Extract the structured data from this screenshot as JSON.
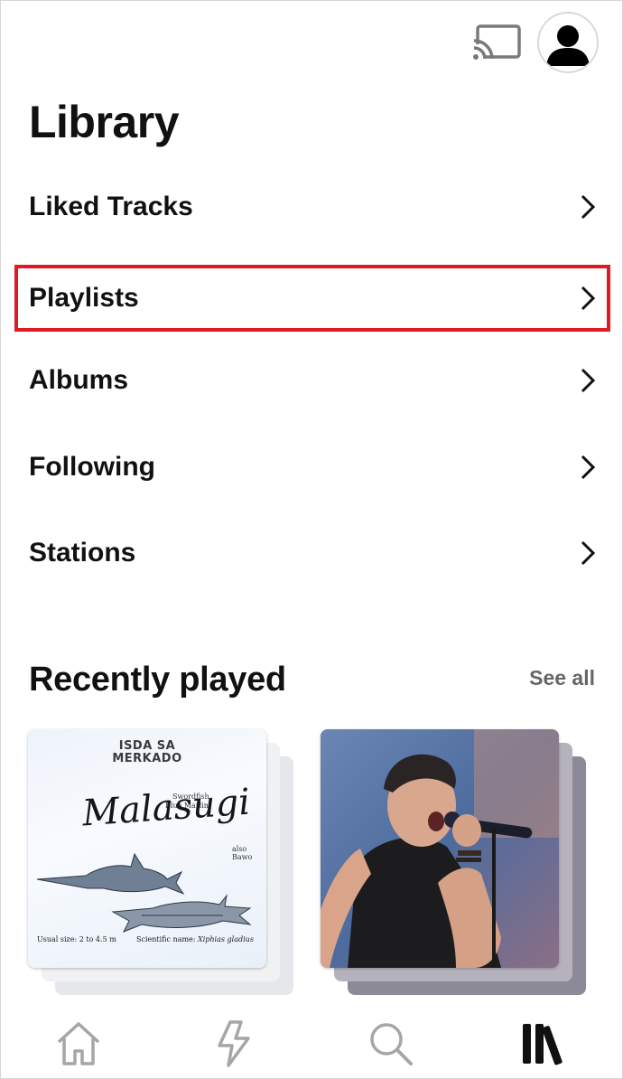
{
  "header": {
    "cast_icon": "cast-icon",
    "avatar_icon": "user-avatar-icon"
  },
  "page": {
    "title": "Library"
  },
  "menu": {
    "items": [
      {
        "label": "Liked Tracks",
        "icon": "chevron-right-icon"
      },
      {
        "label": "Playlists",
        "icon": "chevron-right-icon",
        "highlight_color": "#e01a22"
      },
      {
        "label": "Albums",
        "icon": "chevron-right-icon"
      },
      {
        "label": "Following",
        "icon": "chevron-right-icon"
      },
      {
        "label": "Stations",
        "icon": "chevron-right-icon"
      }
    ]
  },
  "recently_played": {
    "title": "Recently played",
    "see_all": "See all",
    "items": [
      {
        "art_heading_1": "ISDA SA",
        "art_heading_2": "MERKADO",
        "art_script": "Malasugi",
        "art_line_1": "Swordfish",
        "art_line_2": "Blue Marlin",
        "art_line_3": "also Bawo",
        "art_footer_left": "Usual size:  2 to 4.5 m",
        "art_footer_right_prefix": "Scientific name:",
        "art_footer_right_italic": "Xiphias gladius"
      },
      {
        "art_description_icon": "singer-photo"
      }
    ]
  },
  "bottom_nav": {
    "items": [
      {
        "icon": "home-icon"
      },
      {
        "icon": "lightning-icon"
      },
      {
        "icon": "search-icon"
      },
      {
        "icon": "library-icon",
        "active": true
      }
    ]
  },
  "colors": {
    "text": "#111111",
    "muted": "#666666",
    "highlight": "#e01a22",
    "nav_inactive": "#a6a6a6"
  }
}
